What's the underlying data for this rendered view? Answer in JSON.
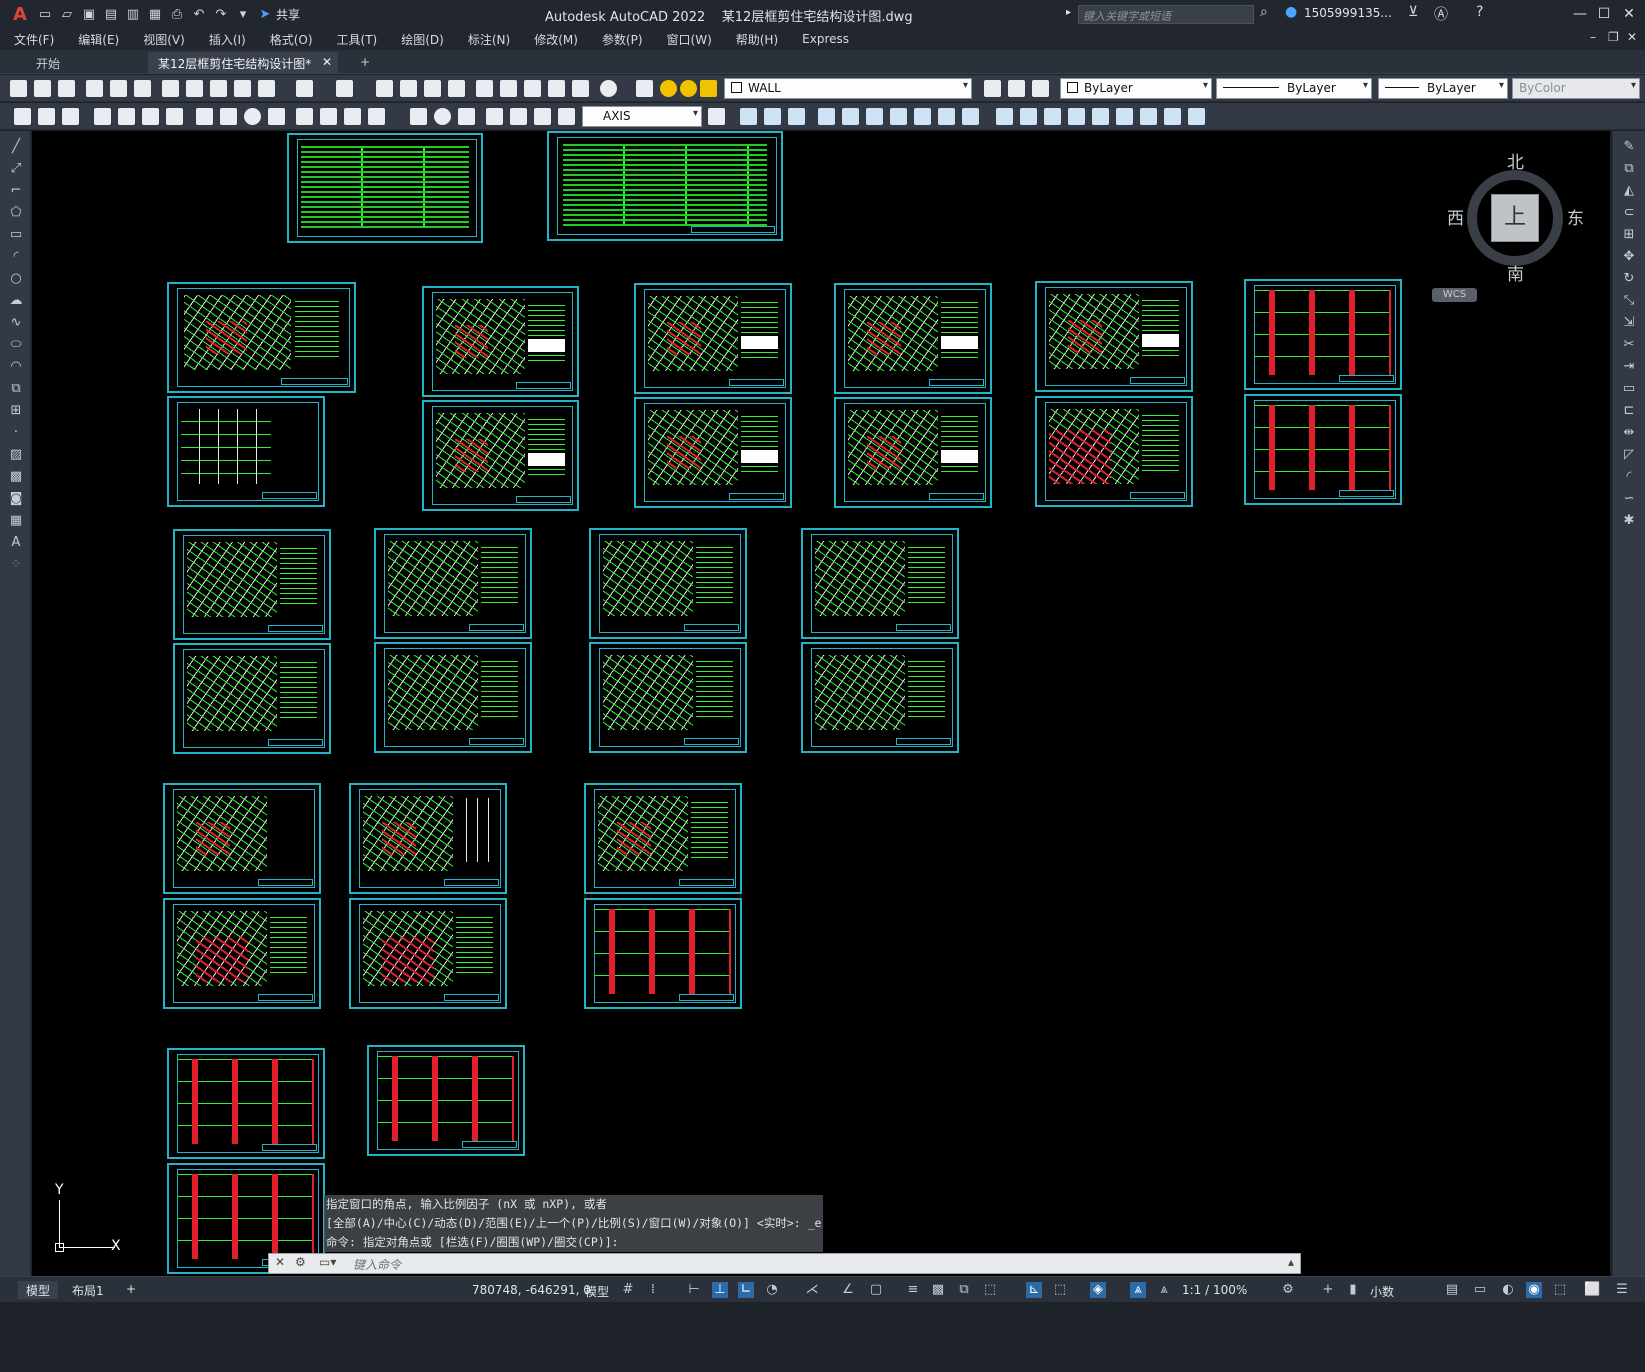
{
  "titlebar": {
    "logo": "A",
    "share": "共享",
    "title": "Autodesk AutoCAD 2022    某12层框剪住宅结构设计图.dwg",
    "search_placeholder": "键入关键字或短语",
    "user": "1505999135...",
    "minimize": "—",
    "maximize": "☐",
    "close": "✕"
  },
  "menu": [
    "文件(F)",
    "编辑(E)",
    "视图(V)",
    "插入(I)",
    "格式(O)",
    "工具(T)",
    "绘图(D)",
    "标注(N)",
    "修改(M)",
    "参数(P)",
    "窗口(W)",
    "帮助(H)",
    "Express"
  ],
  "tabs": {
    "start": "开始",
    "active": "某12层框剪住宅结构设计图*",
    "close": "✕",
    "add": "+"
  },
  "toolbar1": {
    "layer": "WALL",
    "color": "ByLayer",
    "linetype": "ByLayer",
    "lineweight": "ByLayer",
    "plotstyle": "ByColor"
  },
  "toolbar2": {
    "dimstyle": "AXIS"
  },
  "viewcube": {
    "north": "北",
    "south": "南",
    "east": "东",
    "west": "西",
    "top": "上",
    "wcs": "WCS"
  },
  "ucs": {
    "x": "X",
    "y": "Y"
  },
  "command": {
    "history": [
      "指定窗口的角点, 输入比例因子 (nX 或 nXP), 或者",
      "[全部(A)/中心(C)/动态(D)/范围(E)/上一个(P)/比例(S)/窗口(W)/对象(O)] <实时>: _e",
      "命令: 指定对角点或 [栏选(F)/圈围(WP)/圈交(CP)]:"
    ],
    "placeholder": "键入命令"
  },
  "status": {
    "model_tab": "模型",
    "layout_tab": "布局1",
    "add": "+",
    "coords": "780748, -646291, 0",
    "space": "模型",
    "scale": "1:1 / 100%",
    "units": "小数"
  },
  "colors": {
    "sheet_border": "#22b5c9",
    "linework": "#2ef22e",
    "rebar": "#e0202a",
    "canvas": "#000000"
  }
}
